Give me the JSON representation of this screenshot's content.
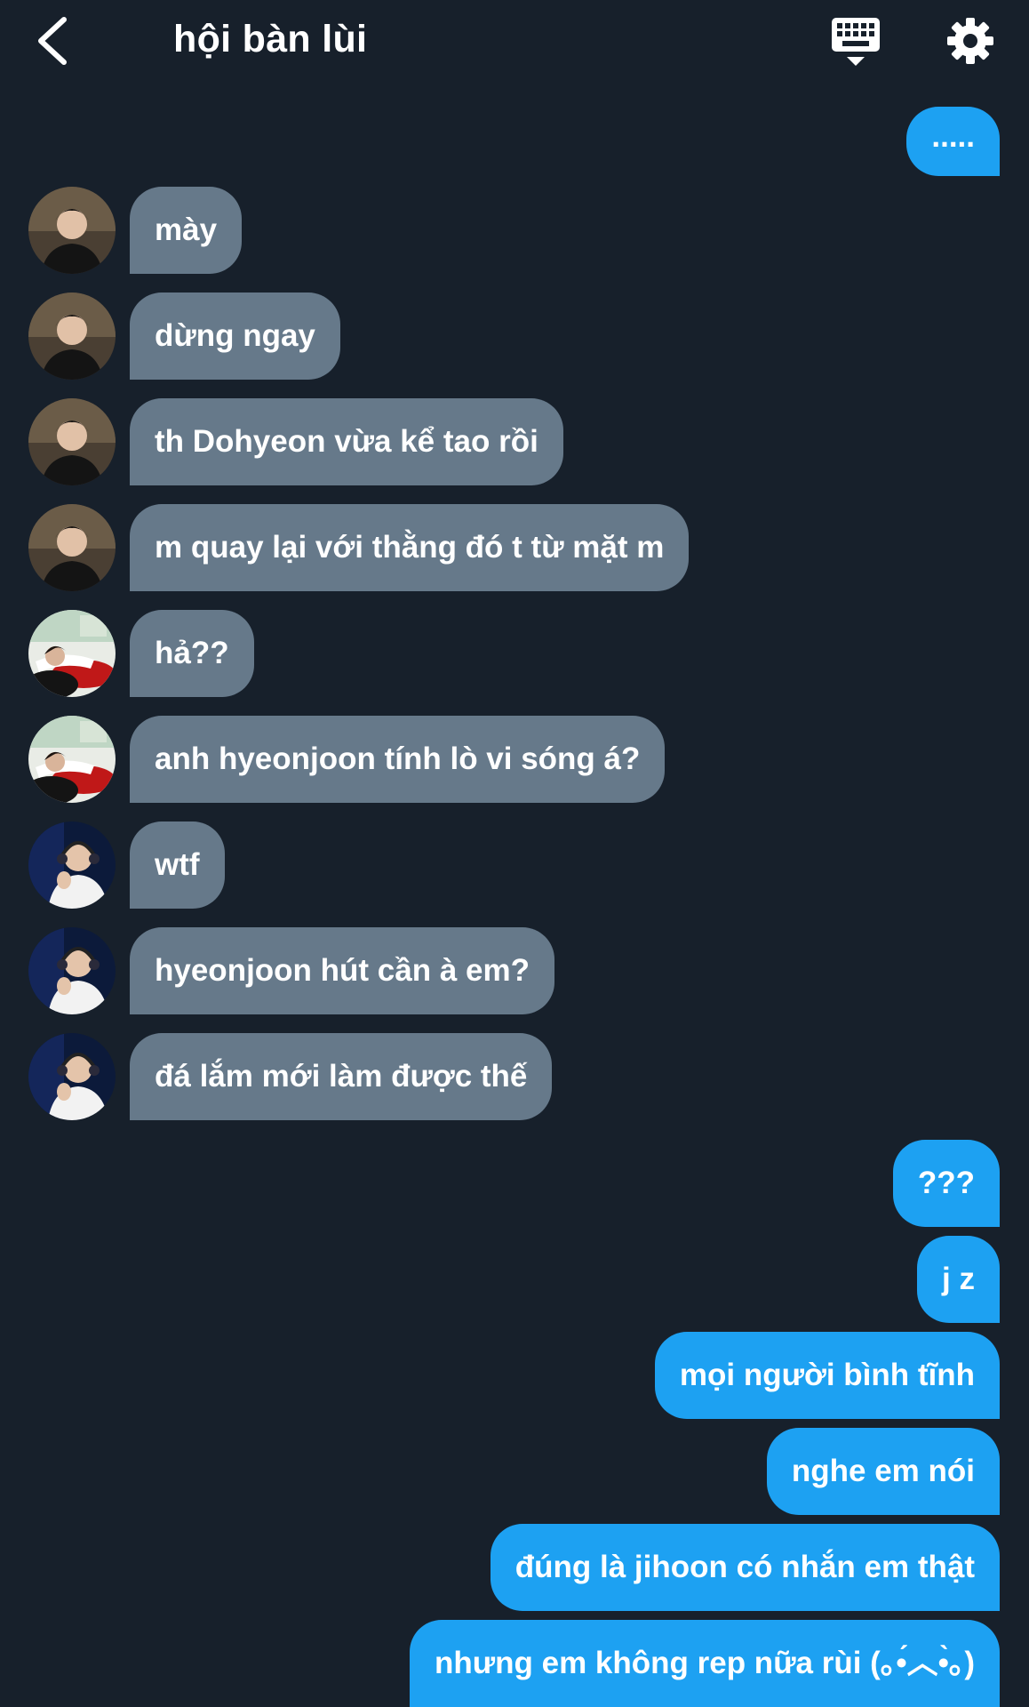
{
  "header": {
    "title": "hội bàn lùi",
    "back_icon": "chevron-left-icon",
    "keyboard_icon": "keyboard-hide-icon",
    "settings_icon": "gear-icon"
  },
  "colors": {
    "background": "#17202b",
    "incoming_bubble": "#66798a",
    "outgoing_bubble": "#1da1f2",
    "text": "#ffffff"
  },
  "messages": [
    {
      "direction": "out",
      "text": "....."
    },
    {
      "direction": "in",
      "sender_avatar": "avatar-a",
      "text": "mày"
    },
    {
      "direction": "in",
      "sender_avatar": "avatar-a",
      "text": "dừng ngay"
    },
    {
      "direction": "in",
      "sender_avatar": "avatar-a",
      "text": "th Dohyeon vừa kể tao rồi"
    },
    {
      "direction": "in",
      "sender_avatar": "avatar-a",
      "text": "m quay lại với thằng đó t từ mặt m"
    },
    {
      "direction": "in",
      "sender_avatar": "avatar-b",
      "text": "hả??"
    },
    {
      "direction": "in",
      "sender_avatar": "avatar-b",
      "text": "anh hyeonjoon tính lò vi sóng á?"
    },
    {
      "direction": "in",
      "sender_avatar": "avatar-c",
      "text": "wtf"
    },
    {
      "direction": "in",
      "sender_avatar": "avatar-c",
      "text": "hyeonjoon hút cần à em?"
    },
    {
      "direction": "in",
      "sender_avatar": "avatar-c",
      "text": "đá lắm mới làm được thế"
    },
    {
      "direction": "out",
      "text": "???"
    },
    {
      "direction": "out",
      "text": "j z"
    },
    {
      "direction": "out",
      "text": "mọi người bình tĩnh"
    },
    {
      "direction": "out",
      "text": "nghe em nói"
    },
    {
      "direction": "out",
      "text": "đúng là jihoon có nhắn em thật"
    },
    {
      "direction": "out",
      "text": "nhưng em không rep nữa rùi (｡•́︿•̀｡)"
    }
  ]
}
